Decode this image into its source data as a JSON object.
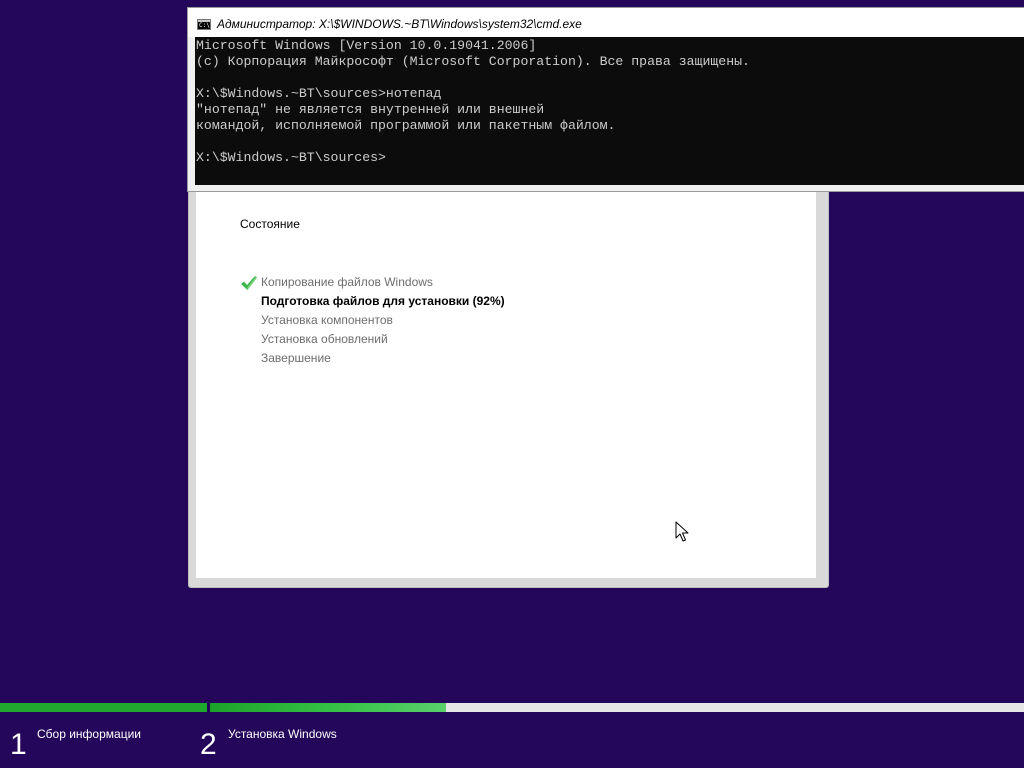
{
  "cmd": {
    "title": "Администратор: X:\\$WINDOWS.~BT\\Windows\\system32\\cmd.exe",
    "icon_label": "C:\\",
    "lines": [
      "Microsoft Windows [Version 10.0.19041.2006]",
      "(c) Корпорация Майкрософт (Microsoft Corporation). Все права защищены.",
      "",
      "X:\\$Windows.~BT\\sources>нотепад",
      "\"нотепад\" не является внутренней или внешней",
      "командой, исполняемой программой или пакетным файлом.",
      "",
      "X:\\$Windows.~BT\\sources>"
    ]
  },
  "setup": {
    "status_title": "Состояние",
    "steps": [
      {
        "label": "Копирование файлов Windows",
        "state": "done"
      },
      {
        "label": "Подготовка файлов для установки (92%)",
        "state": "active"
      },
      {
        "label": "Установка компонентов",
        "state": "pending"
      },
      {
        "label": "Установка обновлений",
        "state": "pending"
      },
      {
        "label": "Завершение",
        "state": "pending"
      }
    ]
  },
  "phases": [
    {
      "number": "1",
      "label": "Сбор информации",
      "progress": 1.0
    },
    {
      "number": "2",
      "label": "Установка Windows",
      "progress": 0.29
    }
  ],
  "colors": {
    "background": "#24075a",
    "progress_green": "#36c148",
    "check_green": "#3cb54a"
  }
}
